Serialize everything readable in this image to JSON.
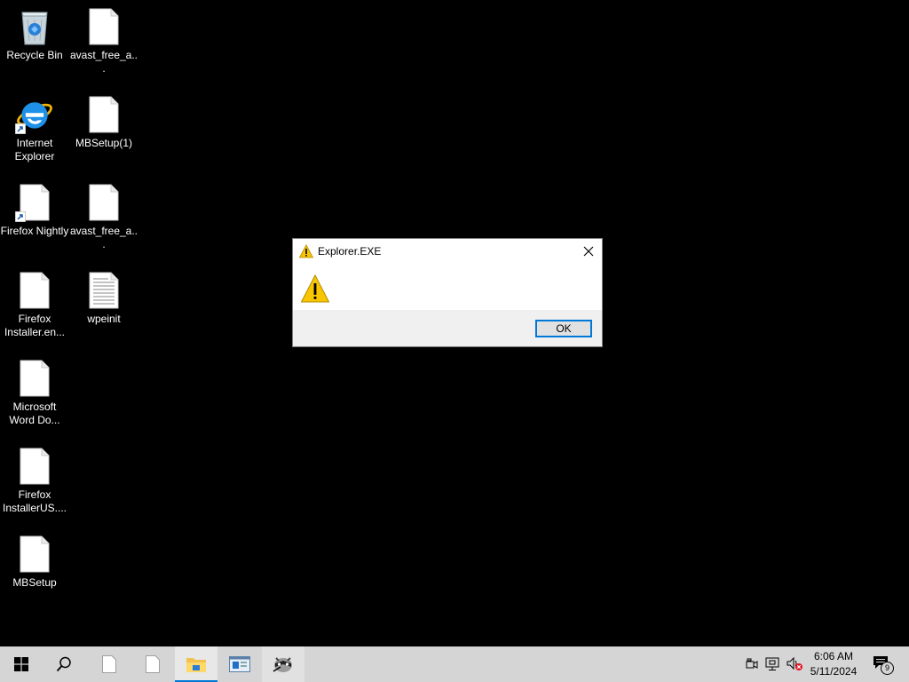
{
  "desktop": {
    "icons": [
      {
        "label": "Recycle Bin",
        "icon": "recycle-bin-icon"
      },
      {
        "label": "avast_free_a...",
        "icon": "blank-file-icon"
      },
      {
        "label": "Internet Explorer",
        "icon": "internet-explorer-icon"
      },
      {
        "label": "MBSetup(1)",
        "icon": "blank-file-icon"
      },
      {
        "label": "Firefox Nightly",
        "icon": "blank-file-icon"
      },
      {
        "label": "avast_free_a...",
        "icon": "blank-file-icon"
      },
      {
        "label": "Firefox Installer.en...",
        "icon": "blank-file-icon"
      },
      {
        "label": "wpeinit",
        "icon": "text-file-icon"
      },
      {
        "label": "Microsoft Word Do...",
        "icon": "blank-file-icon"
      },
      {
        "label": "Firefox InstallerUS....",
        "icon": "blank-file-icon"
      },
      {
        "label": "MBSetup",
        "icon": "blank-file-icon"
      }
    ]
  },
  "dialog": {
    "title": "Explorer.EXE",
    "ok_label": "OK",
    "icon": "warning-icon"
  },
  "taskbar": {
    "time": "6:06 AM",
    "date": "5/11/2024",
    "notification_count": "9",
    "accent": "#0078d7"
  }
}
